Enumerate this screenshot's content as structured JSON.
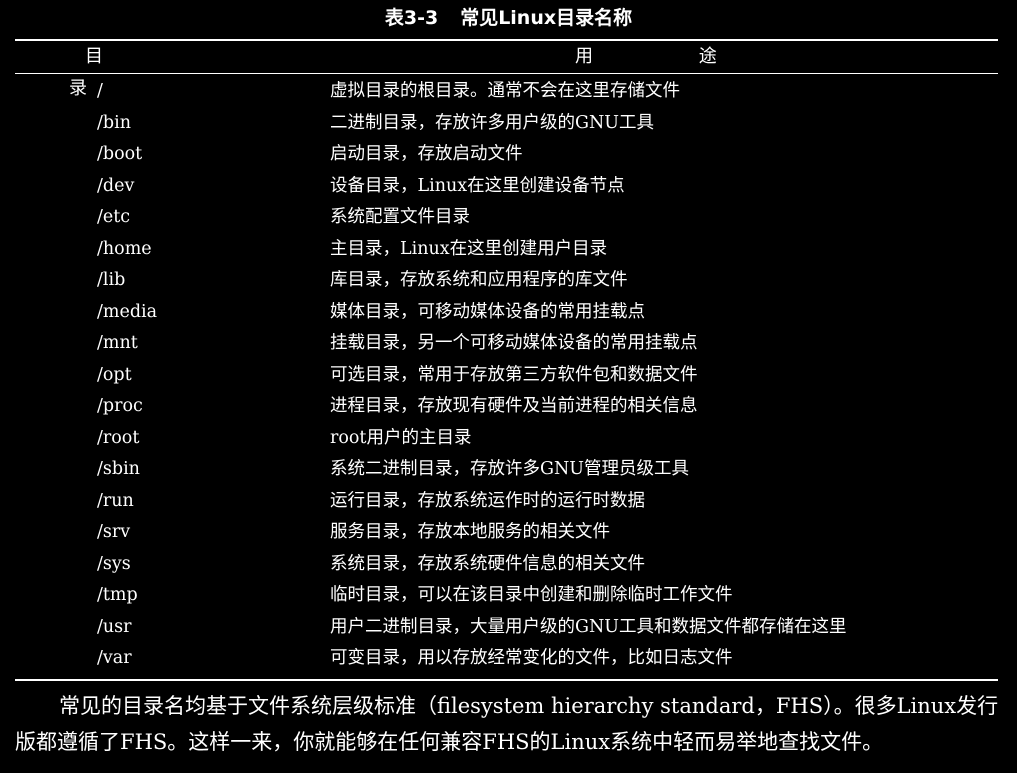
{
  "caption": {
    "number": "表3-3",
    "title": "常见Linux目录名称"
  },
  "table": {
    "headers": [
      "目 录",
      "用 途"
    ],
    "rows": [
      {
        "dir": "/",
        "use": "虚拟目录的根目录。通常不会在这里存储文件"
      },
      {
        "dir": "/bin",
        "use": "二进制目录，存放许多用户级的GNU工具"
      },
      {
        "dir": "/boot",
        "use": "启动目录，存放启动文件"
      },
      {
        "dir": "/dev",
        "use": "设备目录，Linux在这里创建设备节点"
      },
      {
        "dir": "/etc",
        "use": "系统配置文件目录"
      },
      {
        "dir": "/home",
        "use": "主目录，Linux在这里创建用户目录"
      },
      {
        "dir": "/lib",
        "use": "库目录，存放系统和应用程序的库文件"
      },
      {
        "dir": "/media",
        "use": "媒体目录，可移动媒体设备的常用挂载点"
      },
      {
        "dir": "/mnt",
        "use": "挂载目录，另一个可移动媒体设备的常用挂载点"
      },
      {
        "dir": "/opt",
        "use": "可选目录，常用于存放第三方软件包和数据文件"
      },
      {
        "dir": "/proc",
        "use": "进程目录，存放现有硬件及当前进程的相关信息"
      },
      {
        "dir": "/root",
        "use": "root用户的主目录"
      },
      {
        "dir": "/sbin",
        "use": "系统二进制目录，存放许多GNU管理员级工具"
      },
      {
        "dir": "/run",
        "use": "运行目录，存放系统运作时的运行时数据"
      },
      {
        "dir": "/srv",
        "use": "服务目录，存放本地服务的相关文件"
      },
      {
        "dir": "/sys",
        "use": "系统目录，存放系统硬件信息的相关文件"
      },
      {
        "dir": "/tmp",
        "use": "临时目录，可以在该目录中创建和删除临时工作文件"
      },
      {
        "dir": "/usr",
        "use": "用户二进制目录，大量用户级的GNU工具和数据文件都存储在这里"
      },
      {
        "dir": "/var",
        "use": "可变目录，用以存放经常变化的文件，比如日志文件"
      }
    ]
  },
  "paragraph": "常见的目录名均基于文件系统层级标准（filesystem hierarchy standard，FHS）。很多Linux发行版都遵循了FHS。这样一来，你就能够在任何兼容FHS的Linux系统中轻而易举地查找文件。",
  "colors": {
    "background": "#000000",
    "text": "#ffffff"
  }
}
